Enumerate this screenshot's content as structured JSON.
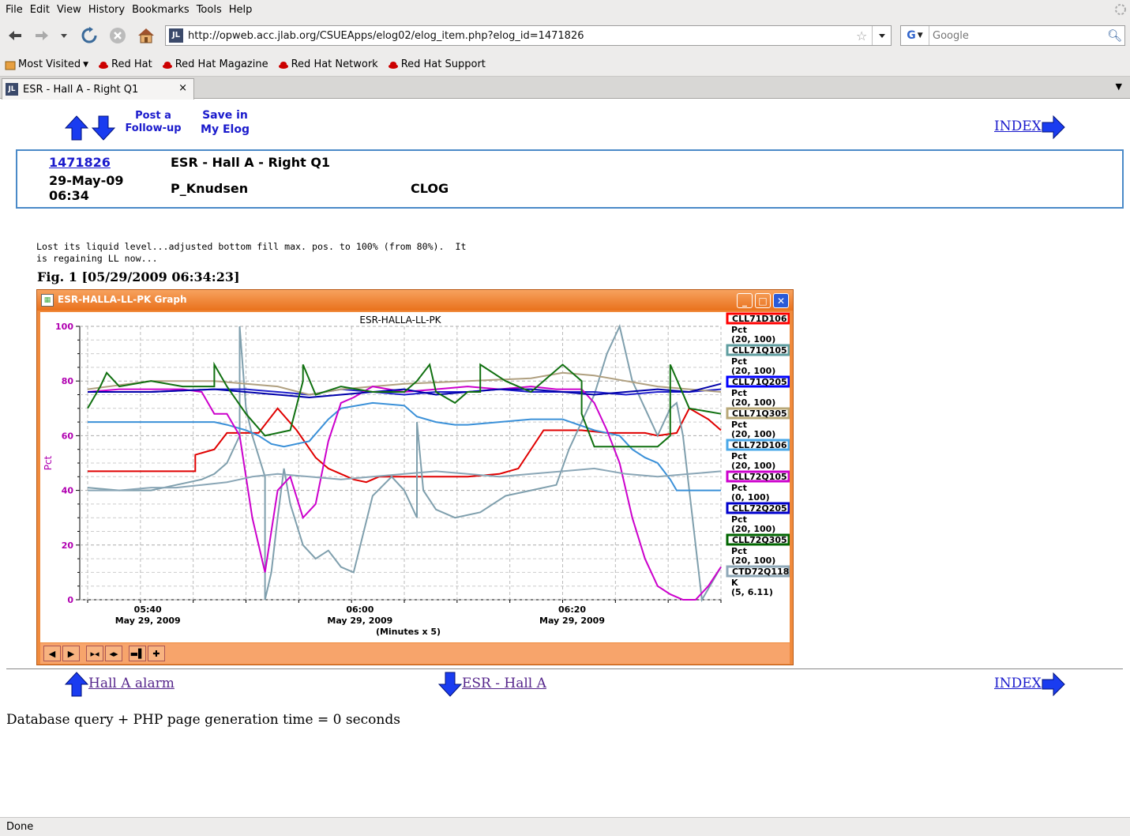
{
  "menubar": {
    "items": [
      "File",
      "Edit",
      "View",
      "History",
      "Bookmarks",
      "Tools",
      "Help"
    ]
  },
  "navbar": {
    "url": "http://opweb.acc.jlab.org/CSUEApps/elog02/elog_item.php?elog_id=1471826",
    "search_placeholder": "Google",
    "search_engine_glyph": "G"
  },
  "bookmarks": {
    "items": [
      "Most Visited",
      "Red Hat",
      "Red Hat Magazine",
      "Red Hat Network",
      "Red Hat Support"
    ]
  },
  "tab": {
    "title": "ESR - Hall A - Right Q1",
    "close": "×"
  },
  "page": {
    "post_followup": [
      "Post a",
      "Follow-up"
    ],
    "save_in": [
      "Save in",
      "My Elog"
    ],
    "index_label": "INDEX",
    "entry": {
      "id": "1471826",
      "title": "ESR - Hall A - Right Q1",
      "date": "29-May-09",
      "time": "06:34",
      "author": "P_Knudsen",
      "logbook": "CLOG"
    },
    "message": "Lost its liquid level...adjusted bottom fill max. pos. to 100% (from 80%).  It\nis regaining LL now...",
    "figure_caption": "Fig. 1 [05/29/2009 06:34:23]",
    "prev_link": "Hall A alarm",
    "next_link": "ESR - Hall A",
    "footer_index": "INDEX",
    "generation_time": "Database query + PHP page generation time = 0 seconds"
  },
  "graph_window": {
    "title": "ESR-HALLA-LL-PK Graph",
    "buttons": [
      "minimize",
      "maximize",
      "close"
    ]
  },
  "chart_data": {
    "type": "line",
    "title": "ESR-HALLA-LL-PK",
    "ylabel": "Pct",
    "xlabel": "(Minutes x 5)",
    "ylim": [
      0,
      100
    ],
    "yticks": [
      "0",
      "20",
      "40",
      "60",
      "80",
      "100"
    ],
    "xticks": [
      {
        "time": "05:40",
        "date": "May 29, 2009"
      },
      {
        "time": "06:00",
        "date": "May 29, 2009"
      },
      {
        "time": "06:20",
        "date": "May 29, 2009"
      }
    ],
    "grid": true,
    "legend_position": "right",
    "legend": [
      {
        "name": "CLL71D106",
        "unit": "Pct",
        "range": "(20, 100)",
        "color": "#ff0000"
      },
      {
        "name": "CLL71Q105",
        "unit": "Pct",
        "range": "(20, 100)",
        "color": "#5f9ea0"
      },
      {
        "name": "CLL71Q205",
        "unit": "Pct",
        "range": "(20, 100)",
        "color": "#0000ff"
      },
      {
        "name": "CLL71Q305",
        "unit": "Pct",
        "range": "(20, 100)",
        "color": "#b8a878"
      },
      {
        "name": "CLL72D106",
        "unit": "Pct",
        "range": "(20, 100)",
        "color": "#4aa8e8"
      },
      {
        "name": "CLL72Q105",
        "unit": "Pct",
        "range": "(0, 100)",
        "color": "#cc00cc"
      },
      {
        "name": "CLL72Q205",
        "unit": "Pct",
        "range": "(20, 100)",
        "color": "#0000cc"
      },
      {
        "name": "CLL72Q305",
        "unit": "Pct",
        "range": "(20, 100)",
        "color": "#006600"
      },
      {
        "name": "CTD72Q118",
        "unit": "K",
        "range": "(5, 6.11)",
        "color": "#8fa8b8"
      }
    ],
    "series": [
      {
        "name": "CLL71D106",
        "color": "#e00000",
        "x": [
          0,
          0.14,
          0.17,
          0.17,
          0.2,
          0.22,
          0.24,
          0.25,
          0.27,
          0.3,
          0.33,
          0.36,
          0.38,
          0.4,
          0.42,
          0.44,
          0.46,
          0.5,
          0.55,
          0.6,
          0.65,
          0.68,
          0.72,
          0.74,
          0.78,
          0.82,
          0.86,
          0.88,
          0.9,
          0.93,
          0.95,
          0.98,
          1.0
        ],
        "y": [
          47,
          47,
          47,
          53,
          55,
          61,
          61,
          61,
          61,
          70,
          62,
          52,
          48,
          46,
          44,
          43,
          45,
          45,
          45,
          45,
          46,
          48,
          62,
          62,
          62,
          61,
          61,
          61,
          60,
          61,
          70,
          66,
          62
        ]
      },
      {
        "name": "CLL71Q105",
        "color": "#7f9fad",
        "x": [
          0,
          0.05,
          0.1,
          0.14,
          0.18,
          0.2,
          0.22,
          0.24,
          0.24,
          0.25,
          0.26,
          0.28,
          0.28,
          0.29,
          0.3,
          0.31,
          0.32,
          0.34,
          0.36,
          0.38,
          0.4,
          0.42,
          0.45,
          0.48,
          0.5,
          0.52,
          0.52,
          0.53,
          0.55,
          0.58,
          0.62,
          0.66,
          0.7,
          0.74,
          0.76,
          0.78,
          0.8,
          0.82,
          0.84,
          0.86,
          0.88,
          0.9,
          0.92,
          0.93,
          0.94,
          0.95,
          0.97,
          1.0
        ],
        "y": [
          41,
          40,
          40,
          42,
          44,
          46,
          50,
          60,
          100,
          70,
          60,
          45,
          0,
          10,
          30,
          48,
          35,
          20,
          15,
          18,
          12,
          10,
          38,
          45,
          40,
          30,
          65,
          40,
          33,
          30,
          32,
          38,
          40,
          42,
          55,
          65,
          75,
          90,
          100,
          80,
          70,
          60,
          70,
          72,
          60,
          40,
          0,
          12
        ]
      },
      {
        "name": "CLL71Q205",
        "color": "#2020cc",
        "x": [
          0,
          0.1,
          0.2,
          0.25,
          0.3,
          0.35,
          0.4,
          0.45,
          0.5,
          0.55,
          0.6,
          0.65,
          0.7,
          0.75,
          0.8,
          0.85,
          0.9,
          0.95,
          1.0
        ],
        "y": [
          76,
          76,
          77,
          77,
          76,
          75,
          77,
          76,
          75,
          76,
          76,
          77,
          76,
          76,
          76,
          75,
          76,
          76,
          77
        ]
      },
      {
        "name": "CLL71Q305",
        "color": "#b0a080",
        "x": [
          0,
          0.1,
          0.2,
          0.3,
          0.35,
          0.4,
          0.5,
          0.6,
          0.7,
          0.75,
          0.8,
          0.85,
          0.9,
          0.95,
          1.0
        ],
        "y": [
          77,
          80,
          80,
          78,
          75,
          77,
          79,
          80,
          81,
          83,
          82,
          80,
          78,
          77,
          76
        ]
      },
      {
        "name": "CLL72D106",
        "color": "#3a90d8",
        "x": [
          0,
          0.1,
          0.2,
          0.22,
          0.25,
          0.27,
          0.29,
          0.31,
          0.35,
          0.38,
          0.4,
          0.45,
          0.5,
          0.52,
          0.55,
          0.58,
          0.6,
          0.65,
          0.7,
          0.75,
          0.8,
          0.84,
          0.86,
          0.88,
          0.9,
          0.92,
          0.93,
          0.95,
          0.97,
          1.0
        ],
        "y": [
          65,
          65,
          65,
          64,
          62,
          60,
          57,
          56,
          58,
          66,
          70,
          72,
          71,
          67,
          65,
          64,
          64,
          65,
          66,
          66,
          62,
          60,
          55,
          52,
          50,
          44,
          40,
          40,
          40,
          40
        ]
      },
      {
        "name": "CLL72Q105",
        "color": "#cc00cc",
        "x": [
          0,
          0.05,
          0.1,
          0.15,
          0.18,
          0.2,
          0.22,
          0.24,
          0.26,
          0.28,
          0.3,
          0.32,
          0.34,
          0.36,
          0.38,
          0.4,
          0.42,
          0.45,
          0.5,
          0.55,
          0.6,
          0.65,
          0.7,
          0.74,
          0.78,
          0.8,
          0.82,
          0.84,
          0.86,
          0.88,
          0.9,
          0.92,
          0.94,
          0.96,
          0.98,
          1.0
        ],
        "y": [
          76,
          77,
          77,
          77,
          76,
          68,
          68,
          60,
          30,
          10,
          40,
          45,
          30,
          35,
          58,
          72,
          74,
          78,
          76,
          77,
          78,
          77,
          78,
          77,
          77,
          72,
          62,
          50,
          30,
          15,
          5,
          2,
          0,
          0,
          5,
          12
        ]
      },
      {
        "name": "CLL72Q205",
        "color": "#0000aa",
        "x": [
          0,
          0.1,
          0.2,
          0.3,
          0.35,
          0.4,
          0.45,
          0.5,
          0.55,
          0.6,
          0.65,
          0.7,
          0.75,
          0.8,
          0.85,
          0.9,
          0.95,
          1.0
        ],
        "y": [
          76,
          76,
          77,
          75,
          74,
          75,
          76,
          77,
          75,
          76,
          77,
          77,
          76,
          75,
          76,
          77,
          76,
          79
        ]
      },
      {
        "name": "CLL72Q305",
        "color": "#107010",
        "x": [
          0,
          0.02,
          0.03,
          0.05,
          0.1,
          0.15,
          0.2,
          0.2,
          0.22,
          0.25,
          0.28,
          0.32,
          0.34,
          0.34,
          0.36,
          0.4,
          0.45,
          0.5,
          0.52,
          0.54,
          0.55,
          0.58,
          0.6,
          0.62,
          0.62,
          0.66,
          0.7,
          0.75,
          0.78,
          0.78,
          0.8,
          0.85,
          0.9,
          0.92,
          0.92,
          0.95,
          1.0
        ],
        "y": [
          70,
          78,
          83,
          78,
          80,
          78,
          78,
          86,
          78,
          68,
          60,
          62,
          80,
          86,
          75,
          78,
          76,
          76,
          80,
          86,
          76,
          72,
          76,
          76,
          86,
          80,
          76,
          86,
          80,
          68,
          56,
          56,
          56,
          60,
          86,
          70,
          68
        ]
      },
      {
        "name": "CTD72Q118",
        "color": "#8aa6b6",
        "x": [
          0,
          0.05,
          0.1,
          0.14,
          0.18,
          0.22,
          0.24,
          0.26,
          0.3,
          0.35,
          0.4,
          0.45,
          0.5,
          0.55,
          0.6,
          0.65,
          0.7,
          0.75,
          0.8,
          0.85,
          0.9,
          0.95,
          1.0
        ],
        "y": [
          40,
          40,
          41,
          41,
          42,
          43,
          44,
          45,
          46,
          45,
          44,
          45,
          46,
          47,
          46,
          45,
          46,
          47,
          48,
          46,
          45,
          46,
          47
        ]
      }
    ]
  }
}
